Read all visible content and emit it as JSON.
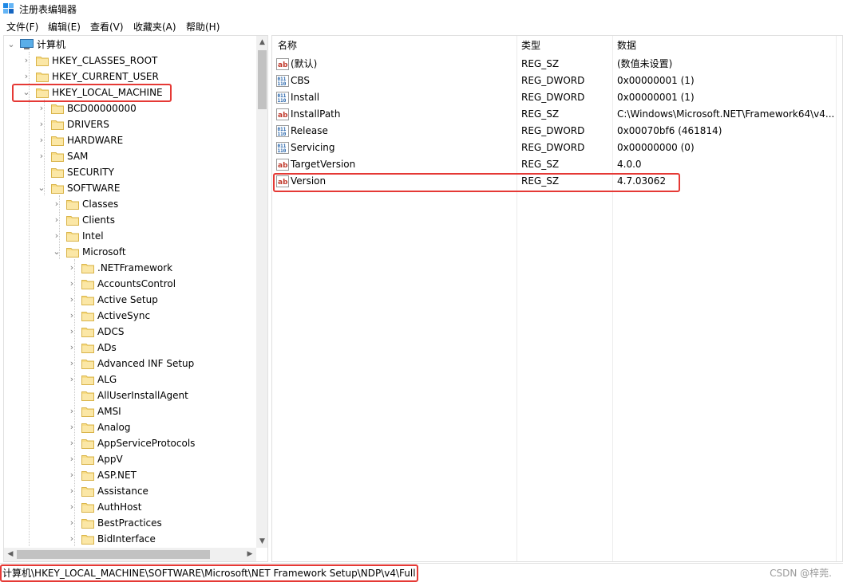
{
  "window": {
    "title": "注册表编辑器"
  },
  "menu": [
    "文件(F)",
    "编辑(E)",
    "查看(V)",
    "收藏夹(A)",
    "帮助(H)"
  ],
  "tree": {
    "root": "计算机",
    "hives": [
      "HKEY_CLASSES_ROOT",
      "HKEY_CURRENT_USER",
      "HKEY_LOCAL_MACHINE"
    ],
    "hklm_children": [
      "BCD00000000",
      "DRIVERS",
      "HARDWARE",
      "SAM",
      "SECURITY",
      "SOFTWARE"
    ],
    "software_children": [
      "Classes",
      "Clients",
      "Intel",
      "Microsoft"
    ],
    "microsoft_children": [
      ".NETFramework",
      "AccountsControl",
      "Active Setup",
      "ActiveSync",
      "ADCS",
      "ADs",
      "Advanced INF Setup",
      "ALG",
      "AllUserInstallAgent",
      "AMSI",
      "Analog",
      "AppServiceProtocols",
      "AppV",
      "ASP.NET",
      "Assistance",
      "AuthHost",
      "BestPractices",
      "BidInterface"
    ]
  },
  "list": {
    "headers": {
      "name": "名称",
      "type": "类型",
      "data": "数据"
    },
    "rows": [
      {
        "icon": "string-value-icon",
        "name": "(默认)",
        "type": "REG_SZ",
        "data": "(数值未设置)"
      },
      {
        "icon": "binary-value-icon",
        "name": "CBS",
        "type": "REG_DWORD",
        "data": "0x00000001 (1)"
      },
      {
        "icon": "binary-value-icon",
        "name": "Install",
        "type": "REG_DWORD",
        "data": "0x00000001 (1)"
      },
      {
        "icon": "string-value-icon",
        "name": "InstallPath",
        "type": "REG_SZ",
        "data": "C:\\Windows\\Microsoft.NET\\Framework64\\v4..."
      },
      {
        "icon": "binary-value-icon",
        "name": "Release",
        "type": "REG_DWORD",
        "data": "0x00070bf6 (461814)"
      },
      {
        "icon": "binary-value-icon",
        "name": "Servicing",
        "type": "REG_DWORD",
        "data": "0x00000000 (0)"
      },
      {
        "icon": "string-value-icon",
        "name": "TargetVersion",
        "type": "REG_SZ",
        "data": "4.0.0"
      },
      {
        "icon": "string-value-icon",
        "name": "Version",
        "type": "REG_SZ",
        "data": "4.7.03062"
      }
    ]
  },
  "status": {
    "path": "计算机\\HKEY_LOCAL_MACHINE\\SOFTWARE\\Microsoft\\NET Framework Setup\\NDP\\v4\\Full"
  },
  "watermark": "CSDN @梓莞.",
  "colors": {
    "highlight": "#e53935",
    "folder": "#f5d77a"
  }
}
